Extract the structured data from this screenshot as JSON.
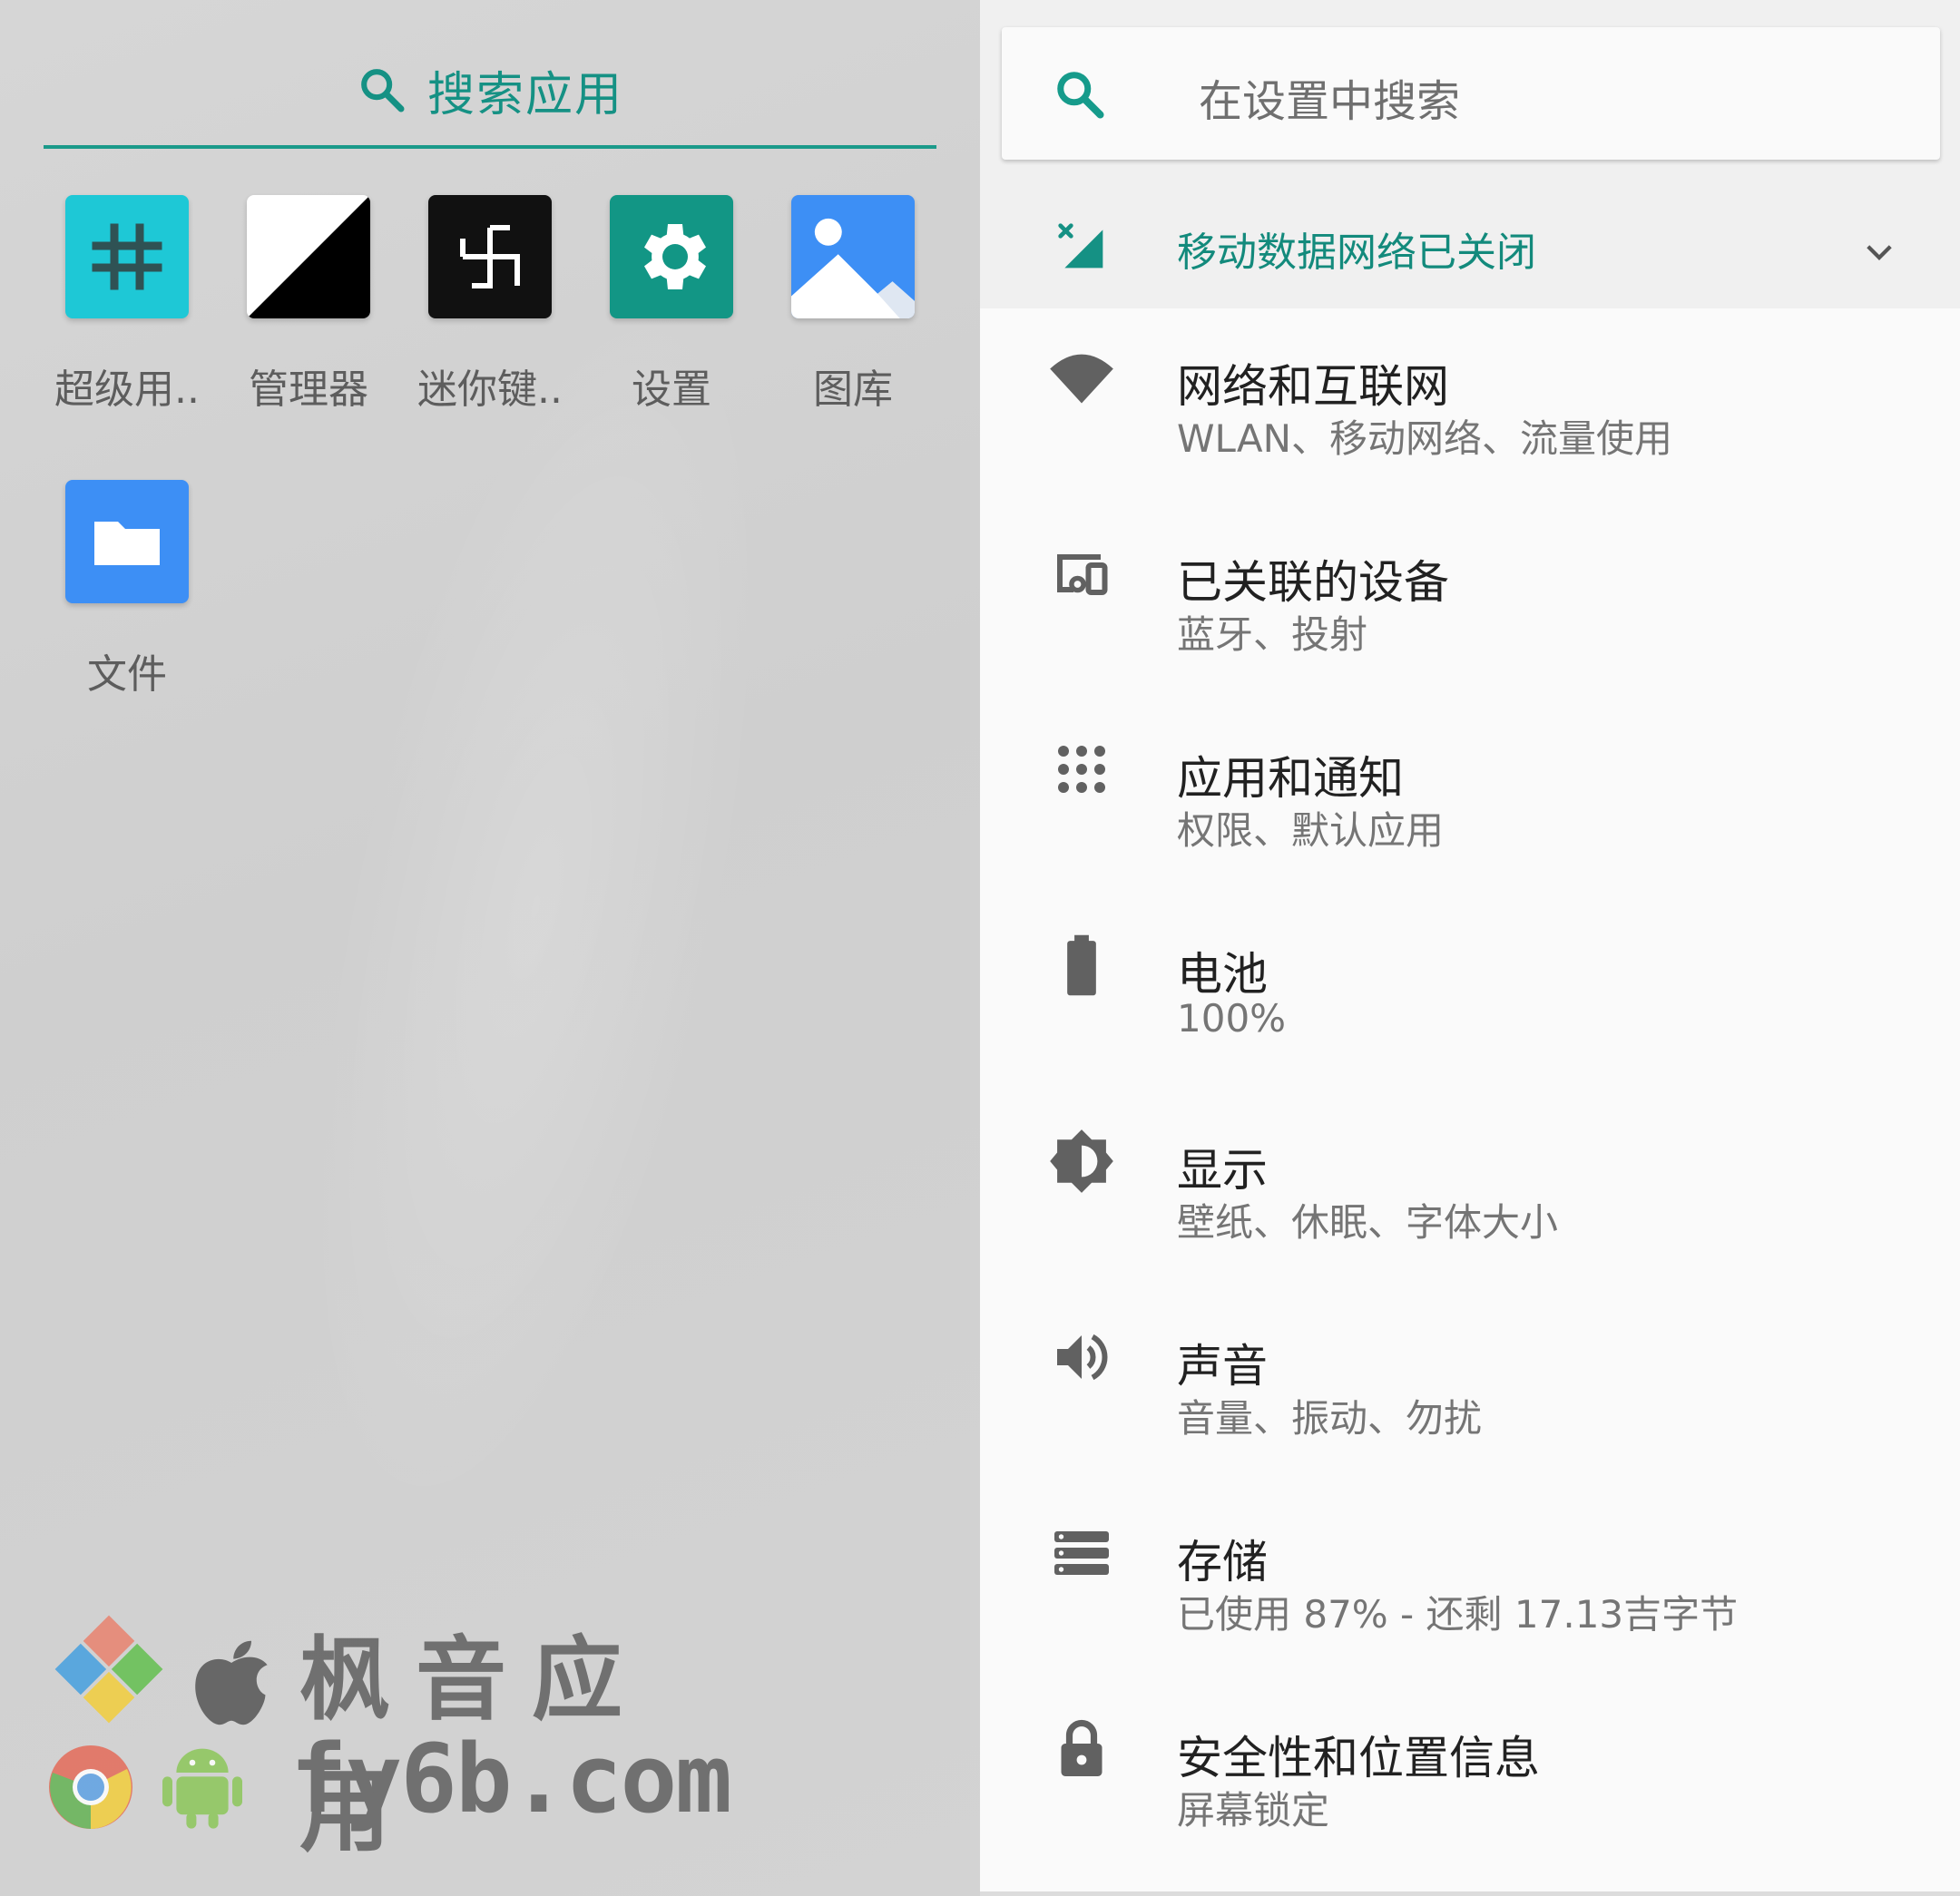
{
  "launcher": {
    "search_label": "搜索应用",
    "apps": [
      {
        "label": "超级用..",
        "icon": "hash-icon",
        "color": "#1ec8d6"
      },
      {
        "label": "管理器",
        "icon": "diagonal-split-icon",
        "color": "#000000"
      },
      {
        "label": "迷你键..",
        "icon": "swirl-icon",
        "color": "#111111"
      },
      {
        "label": "设置",
        "icon": "gear-icon",
        "color": "#129685"
      },
      {
        "label": "图库",
        "icon": "gallery-icon",
        "color": "#3d8ff5"
      },
      {
        "label": "文件",
        "icon": "folder-icon",
        "color": "#3d8ff5"
      }
    ],
    "watermark": {
      "title": "枫音应用",
      "url": "fy6b.com"
    }
  },
  "settings": {
    "search_placeholder": "在设置中搜索",
    "condition": {
      "text": "移动数据网络已关闭",
      "color": "#138a7c"
    },
    "items": [
      {
        "title": "网络和互联网",
        "subtitle": "WLAN、移动网络、流量使用",
        "icon": "wifi-icon"
      },
      {
        "title": "已关联的设备",
        "subtitle": "蓝牙、投射",
        "icon": "devices-icon"
      },
      {
        "title": "应用和通知",
        "subtitle": "权限、默认应用",
        "icon": "apps-icon"
      },
      {
        "title": "电池",
        "subtitle": "100%",
        "icon": "battery-icon"
      },
      {
        "title": "显示",
        "subtitle": "壁纸、休眠、字体大小",
        "icon": "brightness-icon"
      },
      {
        "title": "声音",
        "subtitle": "音量、振动、勿扰",
        "icon": "volume-icon"
      },
      {
        "title": "存储",
        "subtitle": "已使用 87% - 还剩 17.13吉字节",
        "icon": "storage-icon"
      },
      {
        "title": "安全性和位置信息",
        "subtitle": "屏幕锁定",
        "icon": "lock-icon"
      }
    ]
  }
}
